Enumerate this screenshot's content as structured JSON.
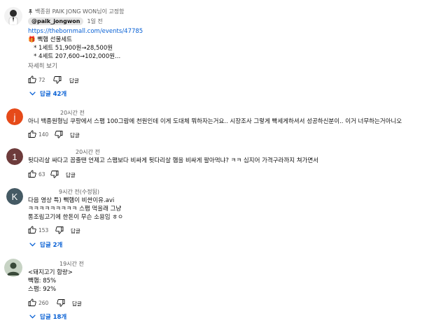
{
  "comments": [
    {
      "pinned_text": "백종원 PAIK JONG WON님이 고정함",
      "author": "@paik_jongwon",
      "time": "1일 전",
      "lines": [
        "https://thebornmall.com/events/47785",
        "🎁 빽햄 선물세트",
        "   * 1세트 51,900원→28,500원",
        "   * 4세트 207,600→102,000원..."
      ],
      "more": "자세히 보기",
      "likes": "72",
      "reply_label": "답글",
      "replies": "답글 42개"
    },
    {
      "avatar_letter": "j",
      "avatar_color": "#e64a19",
      "time": "20시간 전",
      "lines": [
        "아니 백종원형님 쿠팡에서 스팸 100그람에 천원인데 이게 도대체 뭐하자는거요.. 시장조사 그렇게 빡세게하셔서 성공하신분이.. 이거 너무하는거아니오"
      ],
      "likes": "140",
      "reply_label": "답글"
    },
    {
      "avatar_letter": "1",
      "avatar_color": "#6d3b3b",
      "time": "20시간 전",
      "lines": [
        "뒷다리살 싸다고 꼽줄땐 언제고 스팸보다 비싸게 뒷다리살 햄을 비싸게 팔아먹냐? ㅋㅋ 심지어 가격구라까지 쳐가면서"
      ],
      "likes": "63",
      "reply_label": "답글"
    },
    {
      "avatar_letter": "K",
      "avatar_color": "#455a64",
      "time": "9시간 전(수정됨)",
      "lines": [
        "다음 영상 특) 빽햄이 비싼이유.avi",
        "ㅋㅋㅋㅋㅋㅋㅋㅋㅋ 스팸 먹을래 그냥",
        "통조림고기에 한돈이 무슨 소용임 ㅎㅇ"
      ],
      "likes": "153",
      "reply_label": "답글",
      "replies": "답글 2개"
    },
    {
      "time": "19시간 전",
      "lines": [
        "<돼지고기 함량>",
        "빽햄: 85%",
        "스팸: 92%"
      ],
      "likes": "260",
      "reply_label": "답글",
      "replies": "답글 18개"
    }
  ]
}
